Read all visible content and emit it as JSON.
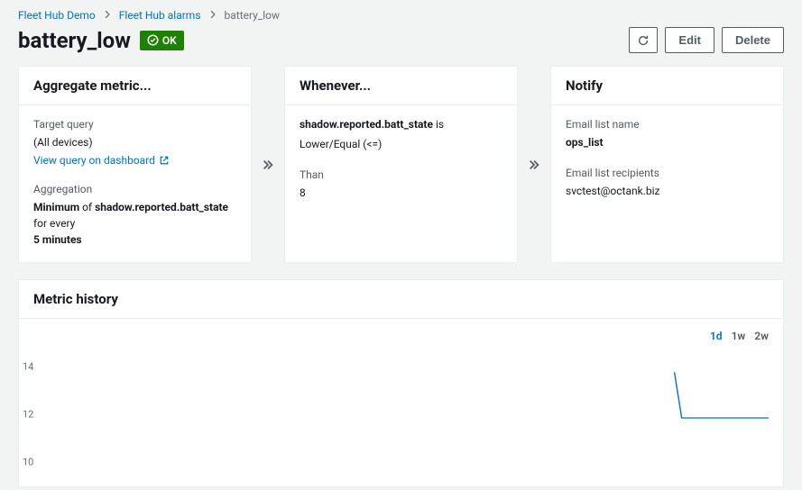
{
  "breadcrumb": {
    "items": [
      {
        "label": "Fleet Hub Demo",
        "link": true
      },
      {
        "label": "Fleet Hub alarms",
        "link": true
      },
      {
        "label": "battery_low",
        "link": false
      }
    ]
  },
  "header": {
    "title": "battery_low",
    "status": "OK",
    "actions": {
      "edit": "Edit",
      "delete": "Delete"
    }
  },
  "cards": {
    "aggregate": {
      "title": "Aggregate metric...",
      "target_query_label": "Target query",
      "target_query_value": "(All devices)",
      "view_link": "View query on dashboard",
      "aggregation_label": "Aggregation",
      "agg_prefix": "Minimum",
      "agg_mid": " of ",
      "agg_field": "shadow.reported.batt_state",
      "agg_suffix": " for every ",
      "agg_period": "5 minutes"
    },
    "whenever": {
      "title": "Whenever...",
      "field": "shadow.reported.batt_state",
      "is_word": " is",
      "operator": "Lower/Equal (<=)",
      "than_label": "Than",
      "threshold": "8"
    },
    "notify": {
      "title": "Notify",
      "list_name_label": "Email list name",
      "list_name": "ops_list",
      "recipients_label": "Email list recipients",
      "recipients": "svctest@octank.biz"
    }
  },
  "metric_history": {
    "title": "Metric history",
    "timeframes": {
      "d1": "1d",
      "w1": "1w",
      "w2": "2w"
    },
    "active_timeframe": "1d"
  },
  "chart_data": {
    "type": "line",
    "y_ticks": [
      10,
      12,
      14
    ],
    "ylim": [
      9,
      15
    ],
    "series": [
      {
        "name": "batt_state",
        "color": "#0073bb",
        "points": [
          {
            "x": 0.87,
            "y": 14
          },
          {
            "x": 0.88,
            "y": 12
          },
          {
            "x": 1.0,
            "y": 12
          }
        ]
      }
    ]
  }
}
